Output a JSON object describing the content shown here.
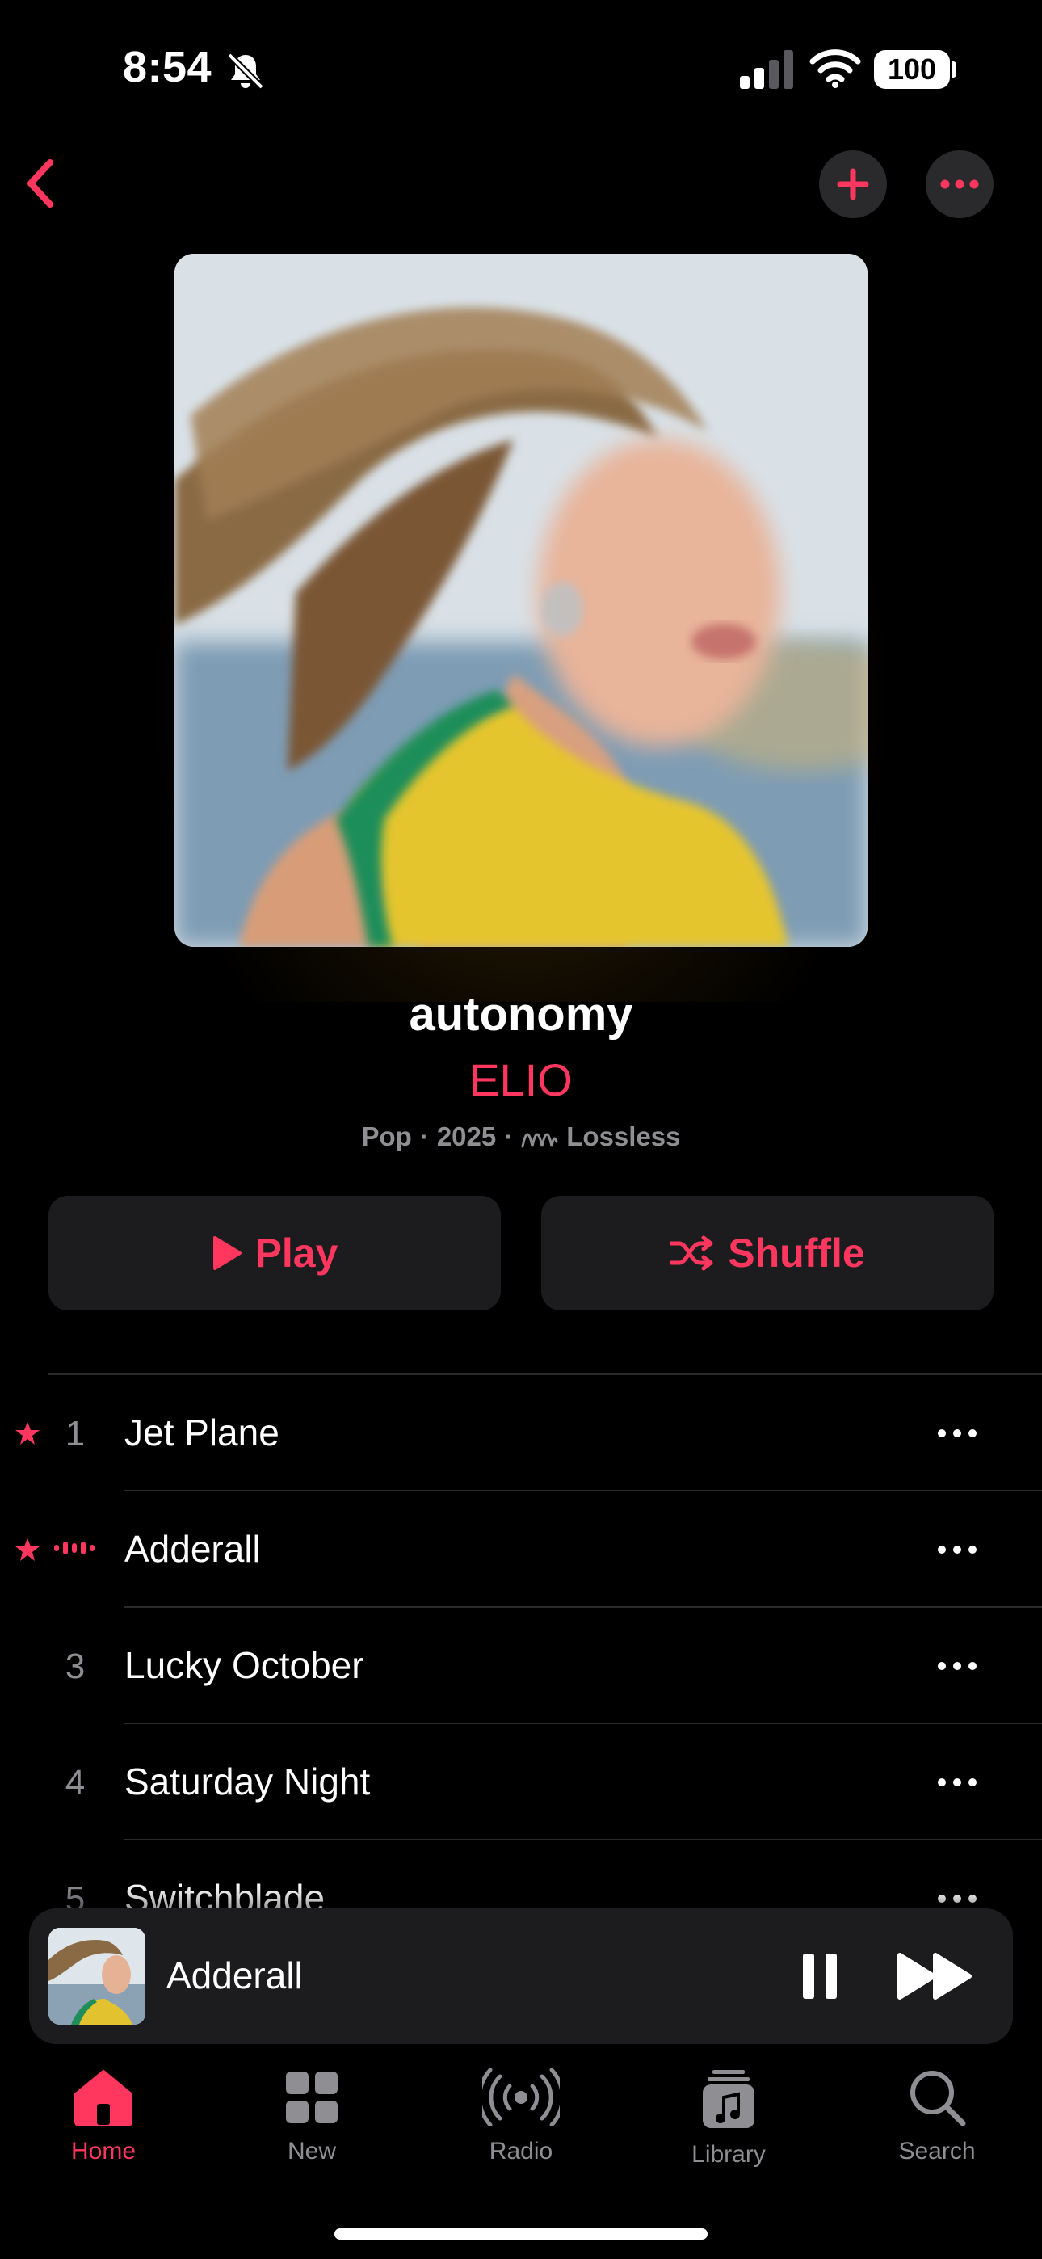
{
  "status_bar": {
    "time": "8:54",
    "battery": "100"
  },
  "album": {
    "title": "autonomy",
    "artist": "ELIO",
    "genre": "Pop",
    "year": "2025",
    "quality": "Lossless",
    "separator": "·"
  },
  "actions": {
    "play_label": "Play",
    "shuffle_label": "Shuffle"
  },
  "tracks": [
    {
      "number": "1",
      "title": "Jet Plane",
      "favorite": true,
      "now_playing": false
    },
    {
      "number": "",
      "title": "Adderall",
      "favorite": true,
      "now_playing": true
    },
    {
      "number": "3",
      "title": "Lucky October",
      "favorite": false,
      "now_playing": false
    },
    {
      "number": "4",
      "title": "Saturday Night",
      "favorite": false,
      "now_playing": false
    },
    {
      "number": "5",
      "title": "Switchblade",
      "favorite": false,
      "now_playing": false
    }
  ],
  "mini_player": {
    "title": "Adderall"
  },
  "tab_bar": {
    "items": [
      {
        "label": "Home",
        "icon": "home-icon",
        "active": true
      },
      {
        "label": "New",
        "icon": "grid-icon",
        "active": false
      },
      {
        "label": "Radio",
        "icon": "radio-icon",
        "active": false
      },
      {
        "label": "Library",
        "icon": "library-icon",
        "active": false
      },
      {
        "label": "Search",
        "icon": "search-icon",
        "active": false
      }
    ]
  },
  "colors": {
    "accent": "#ff375f",
    "background": "#000000",
    "surface": "#1c1c1e",
    "secondary_text": "#8e8e93"
  }
}
